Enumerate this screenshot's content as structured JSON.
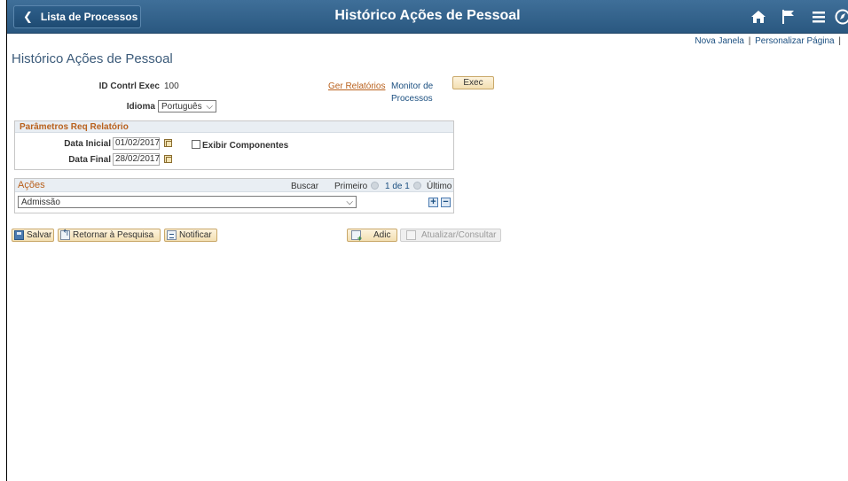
{
  "header": {
    "back_label": "Lista de Processos",
    "title": "Histórico Ações de Pessoal",
    "icons": [
      "home-icon",
      "flag-icon",
      "menu-icon",
      "navbar-compass-icon"
    ]
  },
  "links": {
    "new_window": "Nova Janela",
    "separator": "|",
    "personalize": "Personalizar Página",
    "trailing_sep": "|"
  },
  "page_title": "Histórico Ações de Pessoal",
  "run_control": {
    "id_label": "ID Contrl Exec",
    "id_value": "100",
    "report_manager": "Ger Relatórios",
    "process_monitor_line1": "Monitor de",
    "process_monitor_line2": "Processos",
    "exec_label": "Exec",
    "language_label": "Idioma",
    "language_value": "Português"
  },
  "params": {
    "header": "Parâmetros Req Relatório",
    "start_label": "Data Inicial",
    "start_value": "01/02/2017",
    "end_label": "Data Final",
    "end_value": "28/02/2017",
    "show_components_label": "Exibir Componentes",
    "show_components_checked": false
  },
  "actions_grid": {
    "title": "Ações",
    "find": "Buscar",
    "first": "Primeiro",
    "count": "1 de 1",
    "last": "Último",
    "rows": [
      {
        "action": "Admissão"
      }
    ]
  },
  "toolbar": {
    "save": "Salvar",
    "return_search": "Retornar à Pesquisa",
    "notify": "Notificar",
    "add": "Adic",
    "update_display": "Atualizar/Consultar"
  },
  "colors": {
    "header_bg": "#2f6089",
    "link": "#1b4f80",
    "accent_orange": "#b9611d",
    "button_bg": "#f3dfb2"
  }
}
